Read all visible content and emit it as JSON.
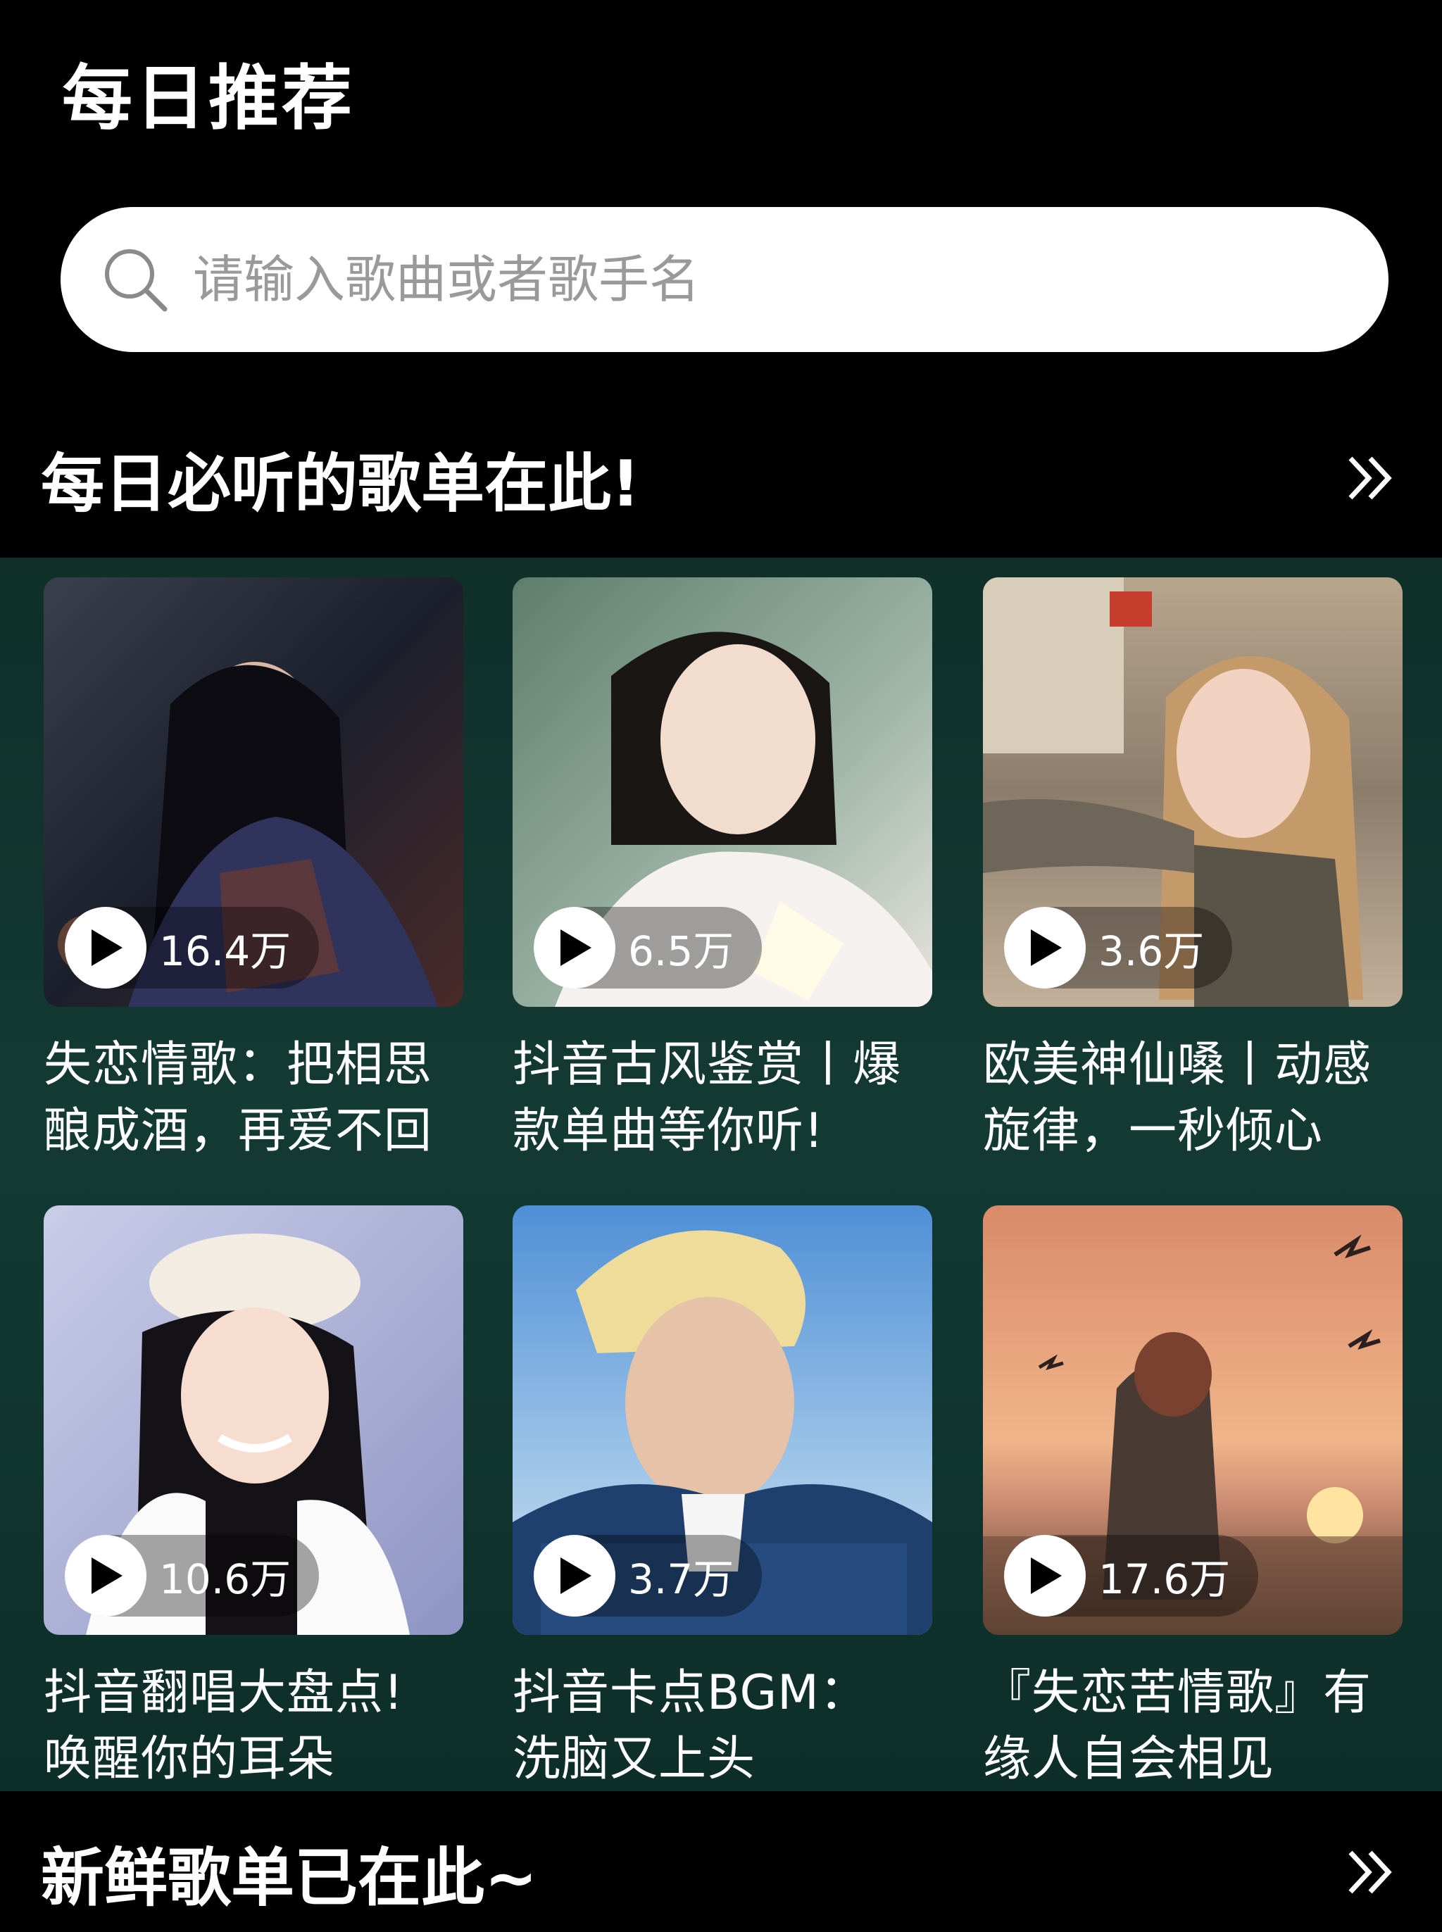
{
  "header": {
    "title": "每日推荐"
  },
  "search": {
    "placeholder": "请输入歌曲或者歌手名"
  },
  "daily_section": {
    "title": "每日必听的歌单在此!"
  },
  "playlists": [
    {
      "title": "失恋情歌：把相思\n酿成酒，再爱不回",
      "plays": "16.4万"
    },
    {
      "title": "抖音古风鉴赏丨爆\n款单曲等你听!",
      "plays": "6.5万"
    },
    {
      "title": "欧美神仙嗓丨动感\n旋律，一秒倾心",
      "plays": "3.6万"
    },
    {
      "title": "抖音翻唱大盘点!\n唤醒你的耳朵",
      "plays": "10.6万"
    },
    {
      "title": "抖音卡点BGM：\n洗脑又上头",
      "plays": "3.7万"
    },
    {
      "title": "『失恋苦情歌』有\n缘人自会相见",
      "plays": "17.6万"
    }
  ],
  "fresh_section": {
    "title": "新鲜歌单已在此~"
  },
  "icons": {
    "search": "search-icon",
    "more": "double-chevron-right-icon",
    "play": "play-icon"
  },
  "colors": {
    "background": "#000000",
    "panel": "#133a33",
    "search_bg": "#ffffff"
  }
}
